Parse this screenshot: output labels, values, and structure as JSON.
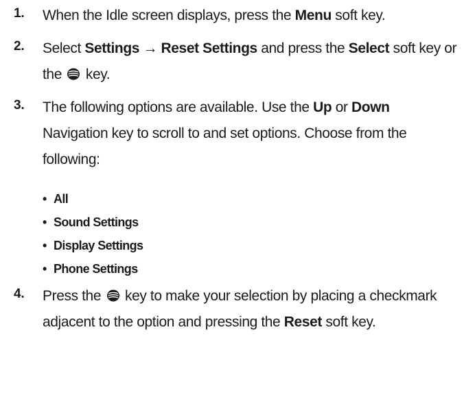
{
  "steps": [
    {
      "number": "1.",
      "parts": [
        {
          "t": "When the Idle screen displays, press the "
        },
        {
          "b": "Menu"
        },
        {
          "t": " soft key."
        }
      ]
    },
    {
      "number": "2.",
      "parts": [
        {
          "t": "Select "
        },
        {
          "b": "Settings → Reset Settings"
        },
        {
          "t": " and press the "
        },
        {
          "b": "Select"
        },
        {
          "t": " soft key or the "
        },
        {
          "icon": "nav-key-icon"
        },
        {
          "t": " key."
        }
      ]
    },
    {
      "number": "3.",
      "parts": [
        {
          "t": "The following options are available. Use the "
        },
        {
          "b": "Up"
        },
        {
          "t": " or "
        },
        {
          "b": "Down"
        },
        {
          "t": " Navigation key to scroll to and set options. Choose from the following:"
        }
      ]
    },
    {
      "number": "4.",
      "parts": [
        {
          "t": "Press the "
        },
        {
          "icon": "nav-key-icon"
        },
        {
          "t": " key to make your selection by placing a checkmark adjacent to the option and pressing the "
        },
        {
          "b": "Reset"
        },
        {
          "t": " soft key."
        }
      ]
    }
  ],
  "options": [
    "All",
    "Sound Settings",
    "Display Settings",
    "Phone Settings"
  ],
  "bullet_char": "•"
}
